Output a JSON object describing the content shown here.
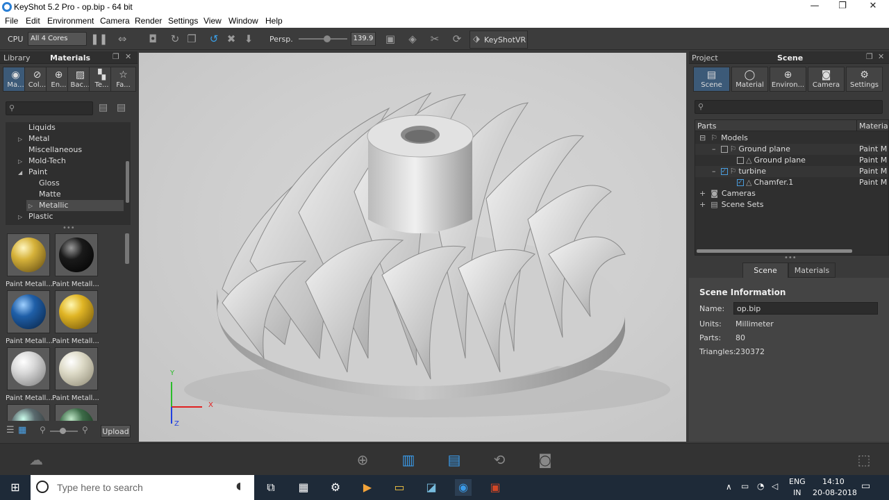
{
  "window": {
    "title": "KeyShot 5.2 Pro  - op.bip  - 64 bit",
    "minimize": "—",
    "maximize": "❐",
    "close": "✕"
  },
  "menu": [
    "File",
    "Edit",
    "Environment",
    "Camera",
    "Render",
    "Settings",
    "View",
    "Window",
    "Help"
  ],
  "toolbar": {
    "cpu_label": "CPU",
    "cores_value": "All 4 Cores",
    "projection_label": "Persp.",
    "fov_value": "139.9",
    "vr_label": "KeyShotVR"
  },
  "library": {
    "header_left": "Library",
    "header_title": "Materials",
    "tabs": [
      {
        "label": "Ma...",
        "icon": "material-ball-icon"
      },
      {
        "label": "Col...",
        "icon": "color-icon"
      },
      {
        "label": "En...",
        "icon": "environment-icon"
      },
      {
        "label": "Bac...",
        "icon": "backplate-icon"
      },
      {
        "label": "Te...",
        "icon": "texture-icon"
      },
      {
        "label": "Fa...",
        "icon": "favorites-icon"
      }
    ],
    "tree": [
      {
        "label": "Liquids",
        "indent": 0,
        "arrow": ""
      },
      {
        "label": "Metal",
        "indent": 0,
        "arrow": "▷"
      },
      {
        "label": "Miscellaneous",
        "indent": 0,
        "arrow": ""
      },
      {
        "label": "Mold-Tech",
        "indent": 0,
        "arrow": "▷"
      },
      {
        "label": "Paint",
        "indent": 0,
        "arrow": "◢"
      },
      {
        "label": "Gloss",
        "indent": 1,
        "arrow": ""
      },
      {
        "label": "Matte",
        "indent": 1,
        "arrow": ""
      },
      {
        "label": "Metallic",
        "indent": 1,
        "arrow": "▷",
        "selected": true
      },
      {
        "label": "Plastic",
        "indent": 0,
        "arrow": "▷"
      }
    ],
    "thumbs": [
      {
        "label": "Paint Metall...",
        "color": "#d6b23a"
      },
      {
        "label": "Paint Metall...",
        "color": "#1a1a1a"
      },
      {
        "label": "Paint Metall...",
        "color": "#1f5fa8"
      },
      {
        "label": "Paint Metall...",
        "color": "#e0b525"
      },
      {
        "label": "Paint Metall...",
        "color": "#d8d8d8"
      },
      {
        "label": "Paint Metall...",
        "color": "#dedbc8"
      },
      {
        "label": "",
        "color": "#5a6a6e"
      },
      {
        "label": "",
        "color": "#3d6b48"
      }
    ],
    "upload_label": "Upload"
  },
  "viewport": {
    "axis_x": "X",
    "axis_y": "Y",
    "axis_z": "Z"
  },
  "project": {
    "header_left": "Project",
    "header_title": "Scene",
    "tabs": [
      {
        "label": "Scene",
        "icon": "scene-icon"
      },
      {
        "label": "Material",
        "icon": "material-icon"
      },
      {
        "label": "Environ...",
        "icon": "environment-icon"
      },
      {
        "label": "Camera",
        "icon": "camera-icon"
      },
      {
        "label": "Settings",
        "icon": "settings-icon"
      }
    ],
    "col_parts": "Parts",
    "col_material": "Materia",
    "tree": [
      {
        "label": "Models",
        "material": "",
        "prefix": "⊟"
      },
      {
        "label": "Ground plane",
        "material": "Paint M",
        "prefix": "–"
      },
      {
        "label": "Ground plane",
        "material": "Paint M",
        "prefix": ""
      },
      {
        "label": "turbine",
        "material": "Paint M",
        "prefix": "–"
      },
      {
        "label": "Chamfer.1",
        "material": "Paint M",
        "prefix": ""
      },
      {
        "label": "Cameras",
        "material": "",
        "prefix": "+"
      },
      {
        "label": "Scene Sets",
        "material": "",
        "prefix": "+"
      }
    ],
    "subtabs": [
      "Scene",
      "Materials"
    ],
    "info": {
      "title": "Scene Information",
      "name_label": "Name:",
      "name_value": "op.bip",
      "units_label": "Units:",
      "units_value": "Millimeter",
      "parts_label": "Parts:",
      "parts_value": "80",
      "triangles_label": "Triangles:",
      "triangles_value": "230372"
    }
  },
  "taskbar": {
    "search_placeholder": "Type here to search",
    "lang1": "ENG",
    "lang2": "IN",
    "time": "14:10",
    "date": "20-08-2018"
  }
}
